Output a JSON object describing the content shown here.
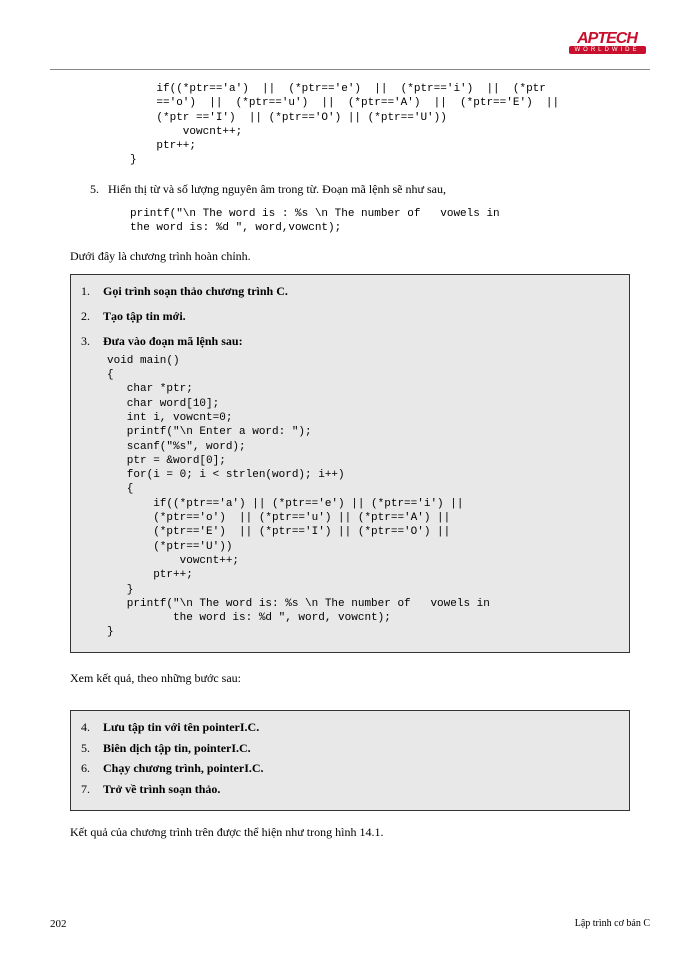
{
  "logo": {
    "main": "APTECH",
    "sub": "WORLDWIDE"
  },
  "topCode": "    if((*ptr=='a')  ||  (*ptr=='e')  ||  (*ptr=='i')  ||  (*ptr\n    =='o')  ||  (*ptr=='u')  ||  (*ptr=='A')  ||  (*ptr=='E')  ||\n    (*ptr =='I')  || (*ptr=='O') || (*ptr=='U'))\n        vowcnt++;\n    ptr++;\n}",
  "step5num": "5.",
  "step5text": "Hiển thị từ và số lượng nguyên âm trong từ. Đoạn mã lệnh sẽ như sau,",
  "step5code": "printf(\"\\n The word is : %s \\n The number of   vowels in\nthe word is: %d \", word,vowcnt);",
  "beforeBox1": "Dưới đây là chương trình hoàn chỉnh.",
  "box1": {
    "li1num": "1.",
    "li1": "Gọi trình soạn thảo chương trình C.",
    "li2num": "2.",
    "li2": "Tạo tập tin mới.",
    "li3num": "3.",
    "li3": "Đưa vào đoạn mã lệnh sau:",
    "code": "void main()\n{\n   char *ptr;\n   char word[10];\n   int i, vowcnt=0;\n   printf(\"\\n Enter a word: \");\n   scanf(\"%s\", word);\n   ptr = &word[0];\n   for(i = 0; i < strlen(word); i++)\n   {\n       if((*ptr=='a') || (*ptr=='e') || (*ptr=='i') ||\n       (*ptr=='o')  || (*ptr=='u') || (*ptr=='A') ||\n       (*ptr=='E')  || (*ptr=='I') || (*ptr=='O') ||\n       (*ptr=='U'))\n           vowcnt++;\n       ptr++;\n   }\n   printf(\"\\n The word is: %s \\n The number of   vowels in\n          the word is: %d \", word, vowcnt);\n}"
  },
  "afterBox1": "Xem kết quả, theo những bước sau:",
  "box2": {
    "li4num": "4.",
    "li4": "Lưu tập tin với tên pointerI.C.",
    "li5num": "5.",
    "li5": "Biên dịch tập tin, pointerI.C.",
    "li6num": "6.",
    "li6": "Chạy chương trình, pointerI.C.",
    "li7num": "7.",
    "li7": "Trở về trình soạn thảo."
  },
  "afterBox2": "Kết quả của chương trình trên được thể hiện như trong hình 14.1.",
  "footer": {
    "page": "202",
    "title": "Lập trình cơ bản C"
  }
}
